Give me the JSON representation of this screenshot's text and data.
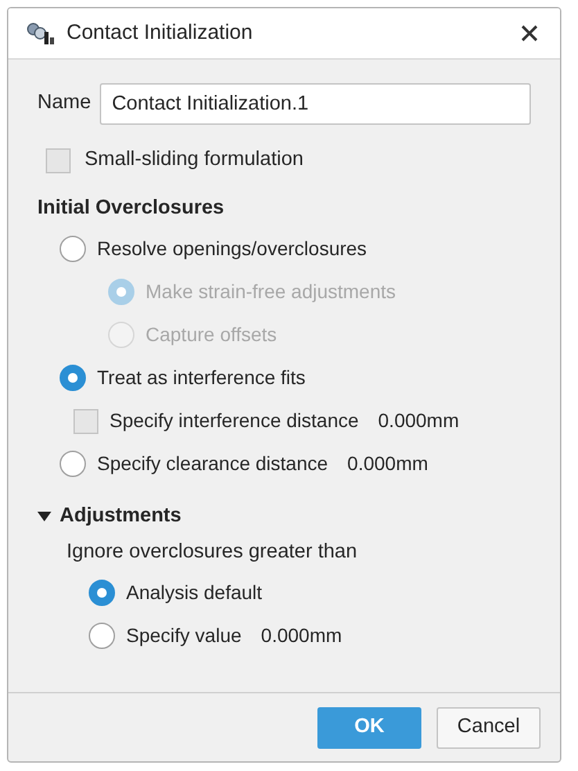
{
  "window": {
    "title": "Contact Initialization"
  },
  "name_field": {
    "label": "Name",
    "value": "Contact Initialization.1"
  },
  "small_sliding": {
    "label": "Small-sliding formulation",
    "checked": false
  },
  "initial_overclosures": {
    "heading": "Initial Overclosures",
    "options": [
      {
        "kind": "radio",
        "label": "Resolve openings/overclosures",
        "selected": false,
        "disabled": false,
        "children": [
          {
            "kind": "radio",
            "label": "Make strain-free adjustments",
            "selected": true,
            "disabled": true
          },
          {
            "kind": "radio",
            "label": "Capture offsets",
            "selected": false,
            "disabled": true
          }
        ]
      },
      {
        "kind": "radio",
        "label": "Treat as interference fits",
        "selected": true,
        "disabled": false,
        "children": [
          {
            "kind": "checkbox",
            "label": "Specify interference distance",
            "value": "0.000mm",
            "checked": false,
            "disabled": false
          }
        ]
      },
      {
        "kind": "radio",
        "label": "Specify clearance distance",
        "value": "0.000mm",
        "selected": false,
        "disabled": false
      }
    ]
  },
  "adjustments": {
    "heading": "Adjustments",
    "expanded": true,
    "prompt": "Ignore overclosures greater than",
    "options": [
      {
        "kind": "radio",
        "label": "Analysis default",
        "selected": true,
        "disabled": false
      },
      {
        "kind": "radio",
        "label": "Specify value",
        "value": "0.000mm",
        "selected": false,
        "disabled": false
      }
    ]
  },
  "buttons": [
    {
      "label": "OK",
      "kind": "primary"
    },
    {
      "label": "Cancel",
      "kind": "secondary"
    }
  ]
}
